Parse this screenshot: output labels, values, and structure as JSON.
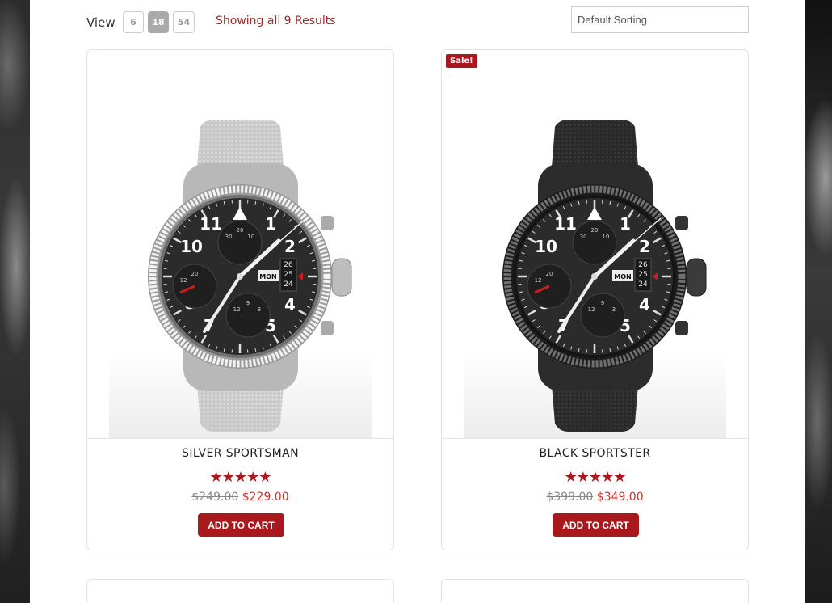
{
  "toolbar": {
    "view_label": "View",
    "view_options": [
      "6",
      "18",
      "54"
    ],
    "active_view": "18",
    "results_text": "Showing all 9 Results",
    "sorting_value": "Default Sorting"
  },
  "products": [
    {
      "title": "SILVER SPORTSMAN",
      "rating": 5,
      "stars": "★★★★★",
      "old_price": "$249.00",
      "new_price": "$229.00",
      "button": "ADD TO CART",
      "sale": false,
      "finish": "silver"
    },
    {
      "title": "BLACK SPORTSTER",
      "rating": 5,
      "stars": "★★★★★",
      "old_price": "$399.00",
      "new_price": "$349.00",
      "button": "ADD TO CART",
      "sale": true,
      "sale_label": "Sale!",
      "finish": "black"
    }
  ],
  "watch_dial": {
    "numerals": [
      "10",
      "2",
      "8",
      "4",
      "7",
      "5",
      "11",
      "1"
    ],
    "day": "MON",
    "dates": [
      "26",
      "25",
      "24"
    ],
    "sub_dial_top": [
      "30",
      "20",
      "10"
    ],
    "sub_dial_left": [
      "12",
      "20"
    ],
    "sub_dial_bottom": [
      "12",
      "9",
      "3"
    ]
  },
  "colors": {
    "accent": "#a8181c",
    "price_new": "#d0312d",
    "results_text": "#9b2a2a"
  }
}
